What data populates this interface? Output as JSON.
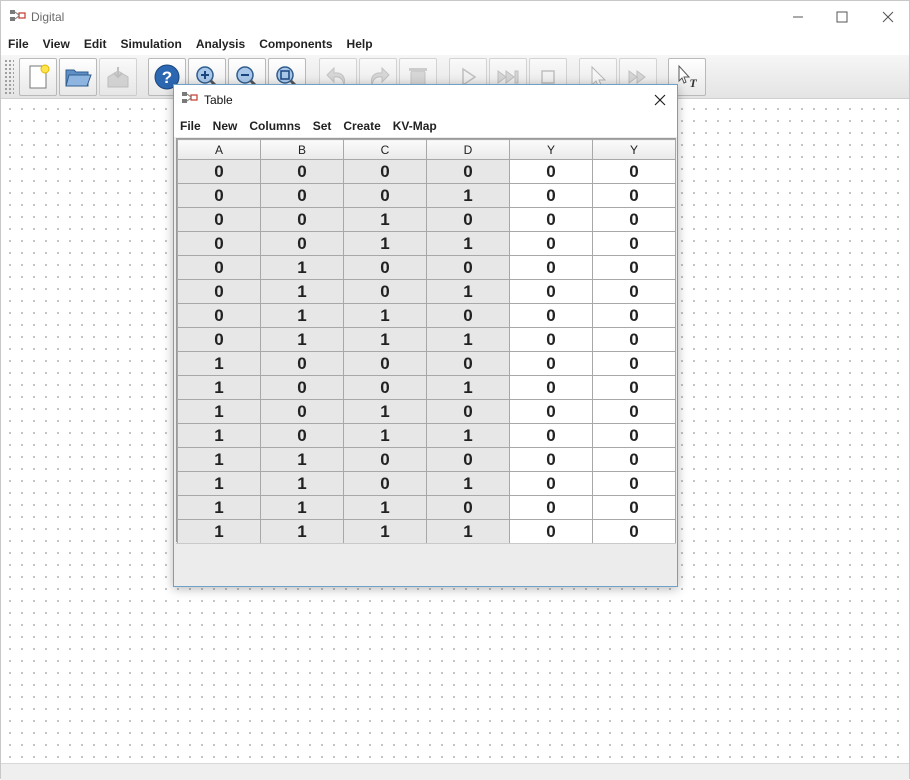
{
  "window": {
    "title": "Digital"
  },
  "menubar": [
    "File",
    "View",
    "Edit",
    "Simulation",
    "Analysis",
    "Components",
    "Help"
  ],
  "toolbar": {
    "buttons": [
      {
        "name": "new-file-button",
        "icon": "new-file-icon",
        "enabled": true
      },
      {
        "name": "open-file-button",
        "icon": "folder-icon",
        "enabled": true
      },
      {
        "name": "save-button",
        "icon": "save-icon",
        "enabled": false
      },
      {
        "name": "help-button",
        "icon": "help-icon",
        "enabled": true
      },
      {
        "name": "zoom-in-button",
        "icon": "zoom-in-icon",
        "enabled": true
      },
      {
        "name": "zoom-out-button",
        "icon": "zoom-out-icon",
        "enabled": true
      },
      {
        "name": "zoom-fit-button",
        "icon": "zoom-fit-icon",
        "enabled": true
      },
      {
        "name": "undo-button",
        "icon": "undo-icon",
        "enabled": false
      },
      {
        "name": "redo-button",
        "icon": "redo-icon",
        "enabled": false
      },
      {
        "name": "delete-button",
        "icon": "trash-icon",
        "enabled": false
      },
      {
        "name": "run-button",
        "icon": "play-icon",
        "enabled": false
      },
      {
        "name": "step-button",
        "icon": "fast-forward-icon",
        "enabled": false
      },
      {
        "name": "stop-button",
        "icon": "stop-icon",
        "enabled": false
      },
      {
        "name": "select-button",
        "icon": "pointer-icon",
        "enabled": false
      },
      {
        "name": "micro-step-button",
        "icon": "double-arrow-icon",
        "enabled": false
      },
      {
        "name": "analyze-button",
        "icon": "test-pointer-icon",
        "enabled": true
      }
    ]
  },
  "dialog": {
    "title": "Table",
    "menu": [
      "File",
      "New",
      "Columns",
      "Set",
      "Create",
      "KV-Map"
    ],
    "columns": [
      "A",
      "B",
      "C",
      "D",
      "Y",
      "Y"
    ],
    "input_columns": 4,
    "rows": [
      [
        "0",
        "0",
        "0",
        "0",
        "0",
        "0"
      ],
      [
        "0",
        "0",
        "0",
        "1",
        "0",
        "0"
      ],
      [
        "0",
        "0",
        "1",
        "0",
        "0",
        "0"
      ],
      [
        "0",
        "0",
        "1",
        "1",
        "0",
        "0"
      ],
      [
        "0",
        "1",
        "0",
        "0",
        "0",
        "0"
      ],
      [
        "0",
        "1",
        "0",
        "1",
        "0",
        "0"
      ],
      [
        "0",
        "1",
        "1",
        "0",
        "0",
        "0"
      ],
      [
        "0",
        "1",
        "1",
        "1",
        "0",
        "0"
      ],
      [
        "1",
        "0",
        "0",
        "0",
        "0",
        "0"
      ],
      [
        "1",
        "0",
        "0",
        "1",
        "0",
        "0"
      ],
      [
        "1",
        "0",
        "1",
        "0",
        "0",
        "0"
      ],
      [
        "1",
        "0",
        "1",
        "1",
        "0",
        "0"
      ],
      [
        "1",
        "1",
        "0",
        "0",
        "0",
        "0"
      ],
      [
        "1",
        "1",
        "0",
        "1",
        "0",
        "0"
      ],
      [
        "1",
        "1",
        "1",
        "0",
        "0",
        "0"
      ],
      [
        "1",
        "1",
        "1",
        "1",
        "0",
        "0"
      ]
    ]
  },
  "colors": {
    "dialog_border": "#6fa0c8",
    "input_cell_bg": "#e7e7e7",
    "output_cell_bg": "#ffffff",
    "help_blue": "#2c67b1"
  }
}
